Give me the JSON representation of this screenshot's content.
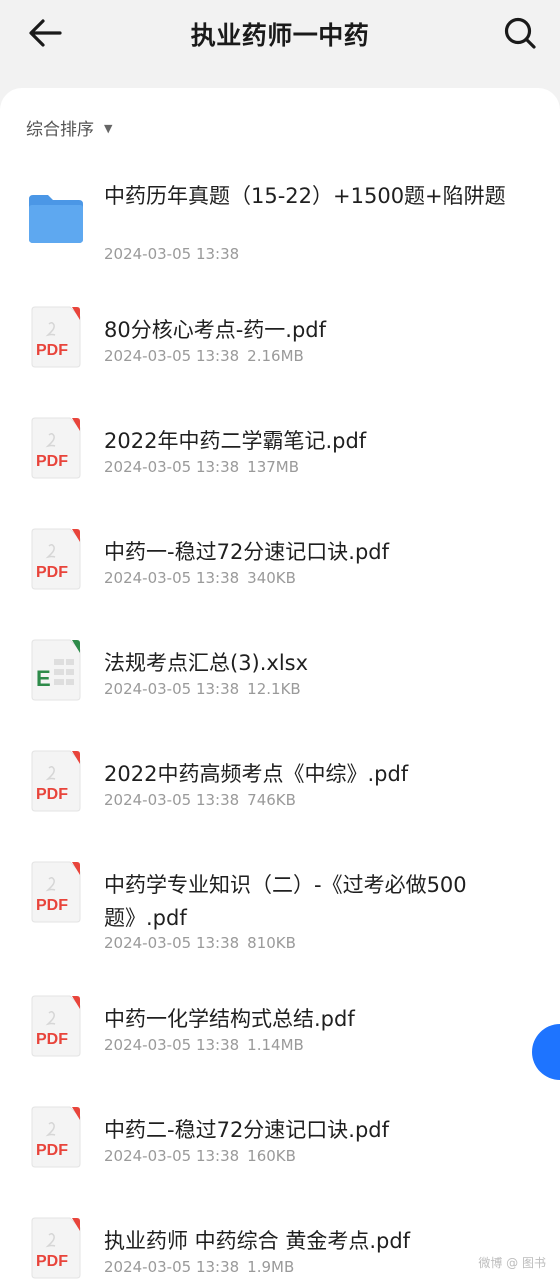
{
  "header": {
    "title": "执业药师一中药",
    "back_icon": "arrow-left-icon",
    "search_icon": "search-icon"
  },
  "sort": {
    "label": "综合排序",
    "arrow_icon": "caret-down-icon"
  },
  "files": [
    {
      "type": "folder",
      "name": "中药历年真题（15-22）+1500题+陷阱题",
      "date": "2024-03-05 13:38",
      "size": ""
    },
    {
      "type": "pdf",
      "name": "80分核心考点-药一.pdf",
      "date": "2024-03-05 13:38",
      "size": "2.16MB"
    },
    {
      "type": "pdf",
      "name": "2022年中药二学霸笔记.pdf",
      "date": "2024-03-05 13:38",
      "size": "137MB"
    },
    {
      "type": "pdf",
      "name": "中药一-稳过72分速记口诀.pdf",
      "date": "2024-03-05 13:38",
      "size": "340KB"
    },
    {
      "type": "xlsx",
      "name": "法规考点汇总(3).xlsx",
      "date": "2024-03-05 13:38",
      "size": "12.1KB"
    },
    {
      "type": "pdf",
      "name": "2022中药高频考点《中综》.pdf",
      "date": "2024-03-05 13:38",
      "size": "746KB"
    },
    {
      "type": "pdf",
      "name": "中药学专业知识（二）-《过考必做500题》.pdf",
      "date": "2024-03-05 13:38",
      "size": "810KB"
    },
    {
      "type": "pdf",
      "name": "中药一化学结构式总结.pdf",
      "date": "2024-03-05 13:38",
      "size": "1.14MB"
    },
    {
      "type": "pdf",
      "name": "中药二-稳过72分速记口诀.pdf",
      "date": "2024-03-05 13:38",
      "size": "160KB"
    },
    {
      "type": "pdf",
      "name": "执业药师 中药综合 黄金考点.pdf",
      "date": "2024-03-05 13:38",
      "size": "1.9MB"
    }
  ],
  "icons": {
    "pdf_label": "PDF",
    "xlsx_label": "E"
  },
  "colors": {
    "pdf_red": "#e8443b",
    "xlsx_green": "#2e8b4a",
    "folder_blue": "#5ea8f0",
    "fab_blue": "#1e74ff"
  }
}
